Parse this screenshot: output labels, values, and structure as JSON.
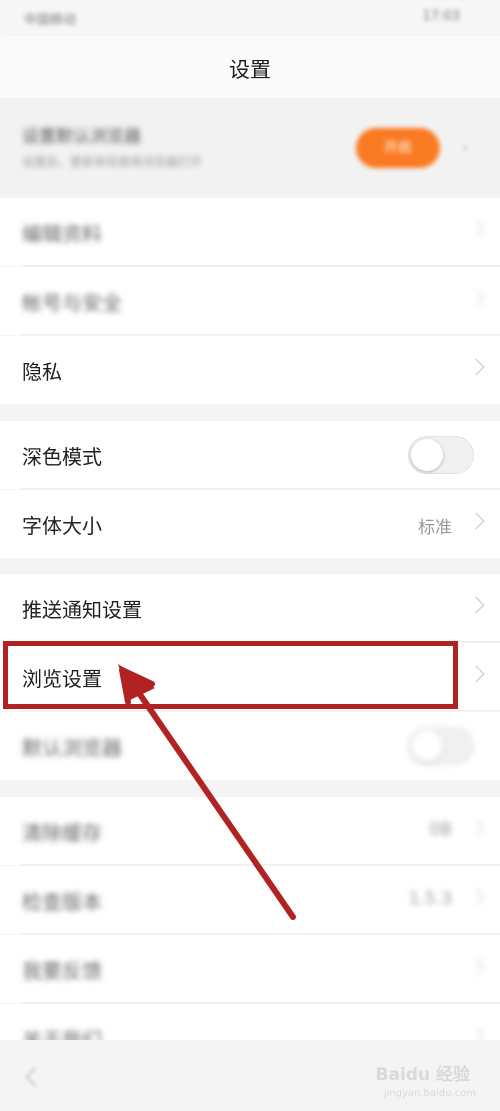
{
  "status_bar": {
    "carrier": "中国移动",
    "time": "17:03"
  },
  "nav": {
    "title": "设置"
  },
  "banner": {
    "title": "设置默认浏览器",
    "subtitle": "设置后，更新体验使用浏览器打开",
    "button_label": "开启"
  },
  "group1": [
    {
      "label": "编辑资料"
    },
    {
      "label": "帐号与安全"
    },
    {
      "label": "隐私"
    }
  ],
  "group2": {
    "dark_mode": {
      "label": "深色模式",
      "enabled": false
    },
    "font_size": {
      "label": "字体大小",
      "value": "标准"
    }
  },
  "group3": {
    "push": {
      "label": "推送通知设置"
    },
    "browse": {
      "label": "浏览设置"
    },
    "default_browser": {
      "label": "默认浏览器",
      "enabled": false
    }
  },
  "group4": [
    {
      "label": "清除缓存",
      "value": "0B"
    },
    {
      "label": "检查版本",
      "value": "1.5.3"
    },
    {
      "label": "我要反馈"
    },
    {
      "label": "关于我们"
    }
  ],
  "watermark": {
    "brand": "Baidu 经验",
    "url": "jingyan.baidu.com"
  },
  "colors": {
    "accent": "#fa7a22",
    "highlight": "#b12222"
  }
}
